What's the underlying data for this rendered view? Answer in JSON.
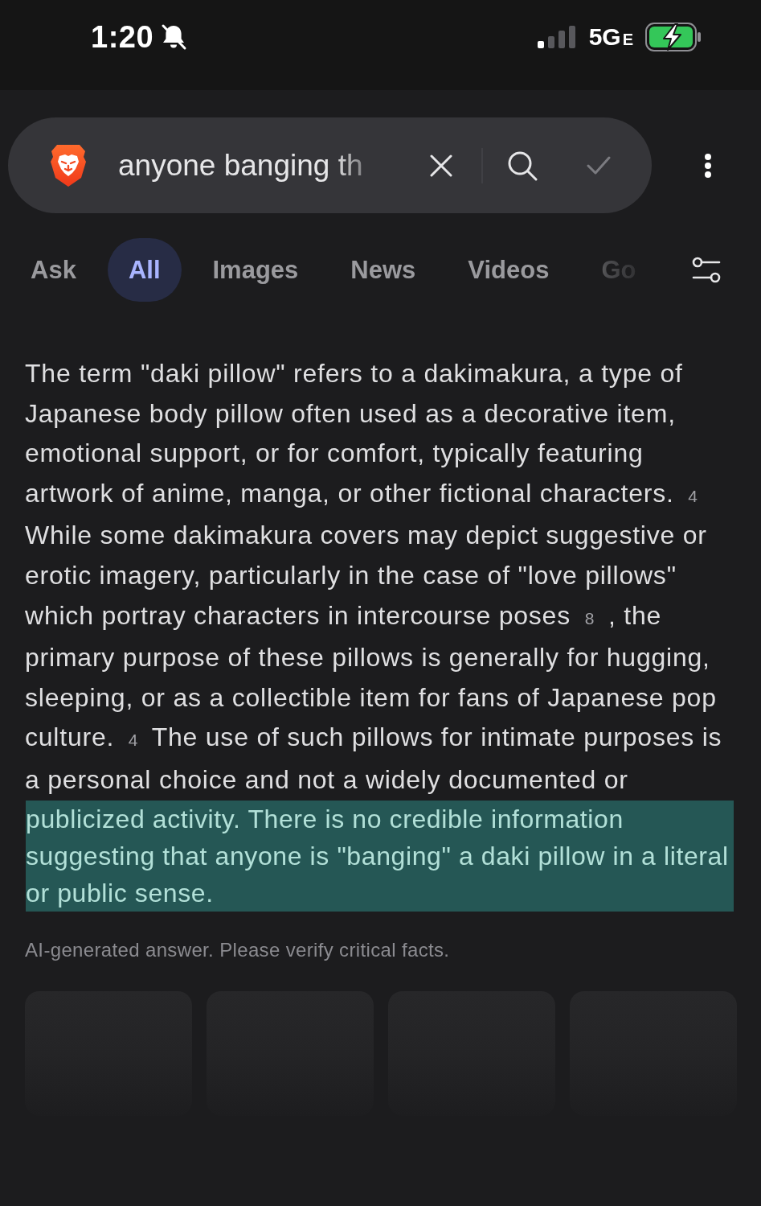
{
  "status_bar": {
    "time": "1:20",
    "silent": true,
    "network": {
      "label": "5G",
      "suffix": "E"
    },
    "battery": {
      "charging": true
    }
  },
  "search_bar": {
    "value": "anyone banging th"
  },
  "tabs": [
    {
      "label": "Ask",
      "selected": false
    },
    {
      "label": "All",
      "selected": true
    },
    {
      "label": "Images",
      "selected": false
    },
    {
      "label": "News",
      "selected": false
    },
    {
      "label": "Videos",
      "selected": false
    },
    {
      "label": "Go",
      "selected": false
    }
  ],
  "answer": {
    "segments": [
      {
        "kind": "text",
        "text": "The term \"daki pillow\" refers to a dakimakura, a type of Japanese body pillow often used as a decorative item, emotional support, or for comfort, typically featuring artwork of anime, manga, or other fictional characters."
      },
      {
        "kind": "citation",
        "text": "4"
      },
      {
        "kind": "text",
        "text": "While some dakimakura covers may depict suggestive or erotic imagery, particularly in the case of \"love pillows\" which portray characters in intercourse poses"
      },
      {
        "kind": "citation",
        "text": "8"
      },
      {
        "kind": "text",
        "text": ", the primary purpose of these pillows is generally for hugging, sleeping, or as a collectible item for fans of Japanese pop culture."
      },
      {
        "kind": "citation",
        "text": "4"
      },
      {
        "kind": "text",
        "text": "The use of such pillows for intimate purposes is a personal choice and not a widely documented or"
      }
    ],
    "highlighted_text": "publicized activity. There is no credible information suggesting that anyone is \"banging\" a daki pillow in a literal or public sense.",
    "disclaimer": "AI-generated answer. Please verify critical facts."
  },
  "result_cards": [
    {
      "kind": "loading"
    },
    {
      "kind": "loading"
    },
    {
      "kind": "loading"
    },
    {
      "kind": "loading"
    }
  ]
}
